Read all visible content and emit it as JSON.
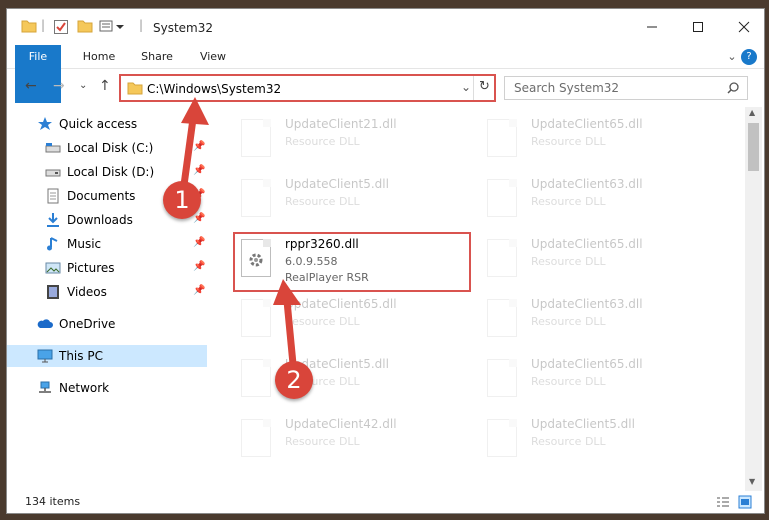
{
  "window": {
    "title": "System32"
  },
  "ribbon": {
    "tabs": [
      {
        "label": "File"
      },
      {
        "label": "Home"
      },
      {
        "label": "Share"
      },
      {
        "label": "View"
      }
    ]
  },
  "address": {
    "path": "C:\\Windows\\System32"
  },
  "search": {
    "placeholder": "Search System32"
  },
  "sidebar": {
    "items": [
      {
        "label": "Quick access",
        "icon": "star-icon"
      },
      {
        "label": "Local Disk (C:)",
        "icon": "drive-icon",
        "pinned": true
      },
      {
        "label": "Local Disk (D:)",
        "icon": "drive-icon",
        "pinned": true
      },
      {
        "label": "Documents",
        "icon": "documents-icon",
        "pinned": true
      },
      {
        "label": "Downloads",
        "icon": "download-icon",
        "pinned": true
      },
      {
        "label": "Music",
        "icon": "music-icon",
        "pinned": true
      },
      {
        "label": "Pictures",
        "icon": "pictures-icon",
        "pinned": true
      },
      {
        "label": "Videos",
        "icon": "videos-icon",
        "pinned": true
      },
      {
        "label": "OneDrive",
        "icon": "cloud-icon"
      },
      {
        "label": "This PC",
        "icon": "computer-icon",
        "selected": true
      },
      {
        "label": "Network",
        "icon": "network-icon"
      }
    ]
  },
  "files": [
    {
      "name": "UpdateClient21.dll",
      "type": "Resource DLL"
    },
    {
      "name": "UpdateClient65.dll",
      "type": "Resource DLL"
    },
    {
      "name": "UpdateClient5.dll",
      "type": "Resource DLL"
    },
    {
      "name": "UpdateClient63.dll",
      "type": "Resource DLL"
    },
    {
      "name": "rppr3260.dll",
      "version": "6.0.9.558",
      "desc": "RealPlayer RSR"
    },
    {
      "name": "UpdateClient65.dll",
      "type": "Resource DLL"
    },
    {
      "name": "UpdateClient65.dll",
      "type": "Resource DLL"
    },
    {
      "name": "UpdateClient63.dll",
      "type": "Resource DLL"
    },
    {
      "name": "UpdateClient5.dll",
      "type": "Resource DLL"
    },
    {
      "name": "UpdateClient65.dll",
      "type": "Resource DLL"
    },
    {
      "name": "UpdateClient42.dll",
      "type": "Resource DLL"
    },
    {
      "name": "UpdateClient5.dll",
      "type": "Resource DLL"
    }
  ],
  "status": {
    "count": "134 items"
  },
  "callouts": [
    "1",
    "2"
  ],
  "colors": {
    "accent": "#1979ca",
    "highlight": "#d9534f",
    "badge": "#d9453a",
    "selected": "#cce8ff"
  }
}
